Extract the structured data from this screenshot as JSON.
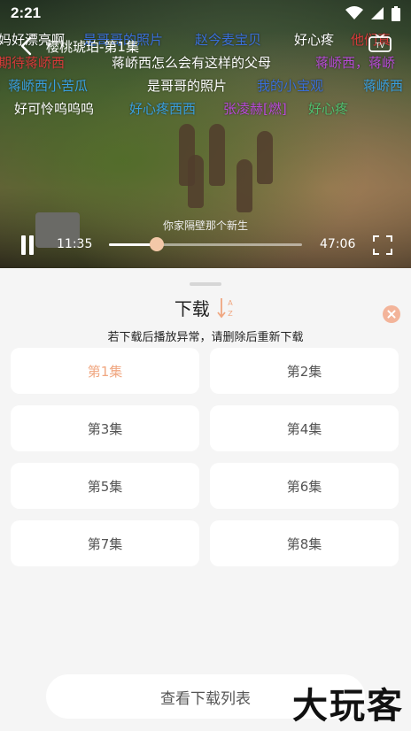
{
  "status": {
    "time": "2:21"
  },
  "player": {
    "title": "樱桃琥珀-第1集",
    "subtitle": "你家隔壁那个新生",
    "current_time": "11:35",
    "duration": "47:06",
    "progress": 0.246,
    "danmaku": [
      {
        "text": "妈好漂亮啊",
        "color": "#ffffff"
      },
      {
        "text": "是哥哥的照片",
        "color": "#3a6fd8"
      },
      {
        "text": "赵今麦宝贝",
        "color": "#3a6fd8"
      },
      {
        "text": "好心疼",
        "color": "#ffffff"
      },
      {
        "text": "他们真",
        "color": "#d83a3a"
      },
      {
        "text": "期待蒋峤西",
        "color": "#d83a3a"
      },
      {
        "text": "蒋峤西怎么会有这样的父母",
        "color": "#ffffff"
      },
      {
        "text": "蒋峤西，蒋峤",
        "color": "#b84ad8"
      },
      {
        "text": "：蒋峤西小苦瓜",
        "color": "#3aa0e0"
      },
      {
        "text": "是哥哥的照片",
        "color": "#ffffff"
      },
      {
        "text": "我的小宝观",
        "color": "#3a6fd8"
      },
      {
        "text": "蒋峤西",
        "color": "#3aa0e0"
      },
      {
        "text": "好可怜呜呜呜",
        "color": "#ffffff"
      },
      {
        "text": "好心疼西西",
        "color": "#3aa0e0"
      },
      {
        "text": "张凌赫[燃]",
        "color": "#b84ad8"
      },
      {
        "text": "好心疼",
        "color": "#50c070"
      }
    ]
  },
  "sheet": {
    "title": "下载",
    "notice": "若下载后播放异常，请删除后重新下载",
    "episodes": [
      "第1集",
      "第2集",
      "第3集",
      "第4集",
      "第5集",
      "第6集",
      "第7集",
      "第8集"
    ],
    "list_button": "查看下载列表",
    "watermark": "大玩客",
    "accent": "#f0a781"
  }
}
